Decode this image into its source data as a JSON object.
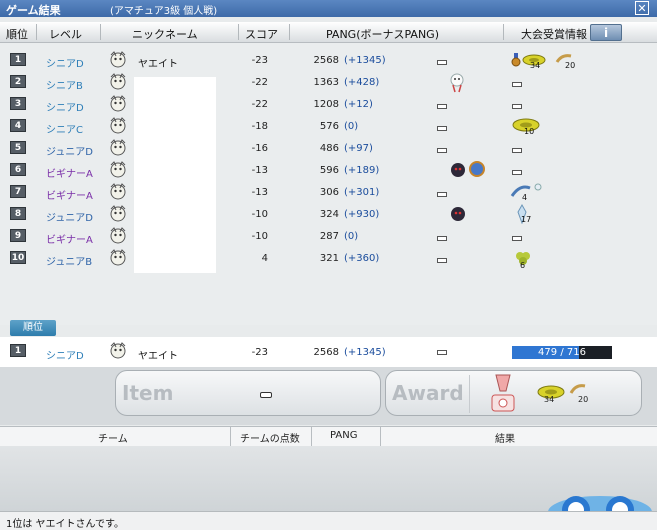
{
  "window": {
    "title": "ゲーム結果",
    "subtitle": "(アマチュア3級 個人戦)",
    "close_icon": "close-icon"
  },
  "header": {
    "rank": "順位",
    "level": "レベル",
    "nickname": "ニックネーム",
    "score": "スコア",
    "pang": "PANG(ボーナスPANG)",
    "award_info": "大会受賞情報",
    "info_button": "i"
  },
  "colors": {
    "senior": "#2f7fb8",
    "junior": "#2f64a8",
    "beginner": "#7a2fa8",
    "bonus": "#1a4c9c",
    "exp_fill": "#2f76d2"
  },
  "rows": [
    {
      "rank": "1",
      "level": "シニアD",
      "level_kind": "senior",
      "nickname": "ヤエイト",
      "score": "-23",
      "pang": "2568",
      "bonus": "(+1345)"
    },
    {
      "rank": "2",
      "level": "シニアB",
      "level_kind": "senior",
      "nickname": "",
      "score": "-22",
      "pang": "1363",
      "bonus": "(+428)"
    },
    {
      "rank": "3",
      "level": "シニアD",
      "level_kind": "senior",
      "nickname": "",
      "score": "-22",
      "pang": "1208",
      "bonus": "(+12)"
    },
    {
      "rank": "4",
      "level": "シニアC",
      "level_kind": "senior",
      "nickname": "",
      "score": "-18",
      "pang": "576",
      "bonus": "(0)"
    },
    {
      "rank": "5",
      "level": "ジュニアD",
      "level_kind": "junior",
      "nickname": "",
      "score": "-16",
      "pang": "486",
      "bonus": "(+97)"
    },
    {
      "rank": "6",
      "level": "ビギナーA",
      "level_kind": "beginner",
      "nickname": "",
      "score": "-13",
      "pang": "596",
      "bonus": "(+189)"
    },
    {
      "rank": "7",
      "level": "ビギナーA",
      "level_kind": "beginner",
      "nickname": "",
      "score": "-13",
      "pang": "306",
      "bonus": "(+301)"
    },
    {
      "rank": "8",
      "level": "ジュニアD",
      "level_kind": "junior",
      "nickname": "",
      "score": "-10",
      "pang": "324",
      "bonus": "(+930)"
    },
    {
      "rank": "9",
      "level": "ビギナーA",
      "level_kind": "beginner",
      "nickname": "",
      "score": "-10",
      "pang": "287",
      "bonus": "(0)"
    },
    {
      "rank": "10",
      "level": "ジュニアB",
      "level_kind": "junior",
      "nickname": "",
      "score": "4",
      "pang": "321",
      "bonus": "(+360)"
    }
  ],
  "award_counts": {
    "row1_a": "34",
    "row1_b": "20",
    "row4": "10",
    "row7": "4",
    "row8": "17",
    "row10": "6"
  },
  "my_result": {
    "tab": "順位",
    "rank": "1",
    "level": "シニアD",
    "nickname": "ヤエイト",
    "score": "-23",
    "pang": "2568",
    "bonus": "(+1345)",
    "exp_text": "479 / 716",
    "exp_progress": 0.669
  },
  "panel": {
    "item_label": "Item",
    "award_label": "Award",
    "award_count_a": "34",
    "award_count_b": "20"
  },
  "team_header": {
    "team": "チーム",
    "team_score": "チームの点数",
    "pang": "PANG",
    "result": "結果"
  },
  "status": {
    "message": "1位は ヤエイトさんです。"
  }
}
